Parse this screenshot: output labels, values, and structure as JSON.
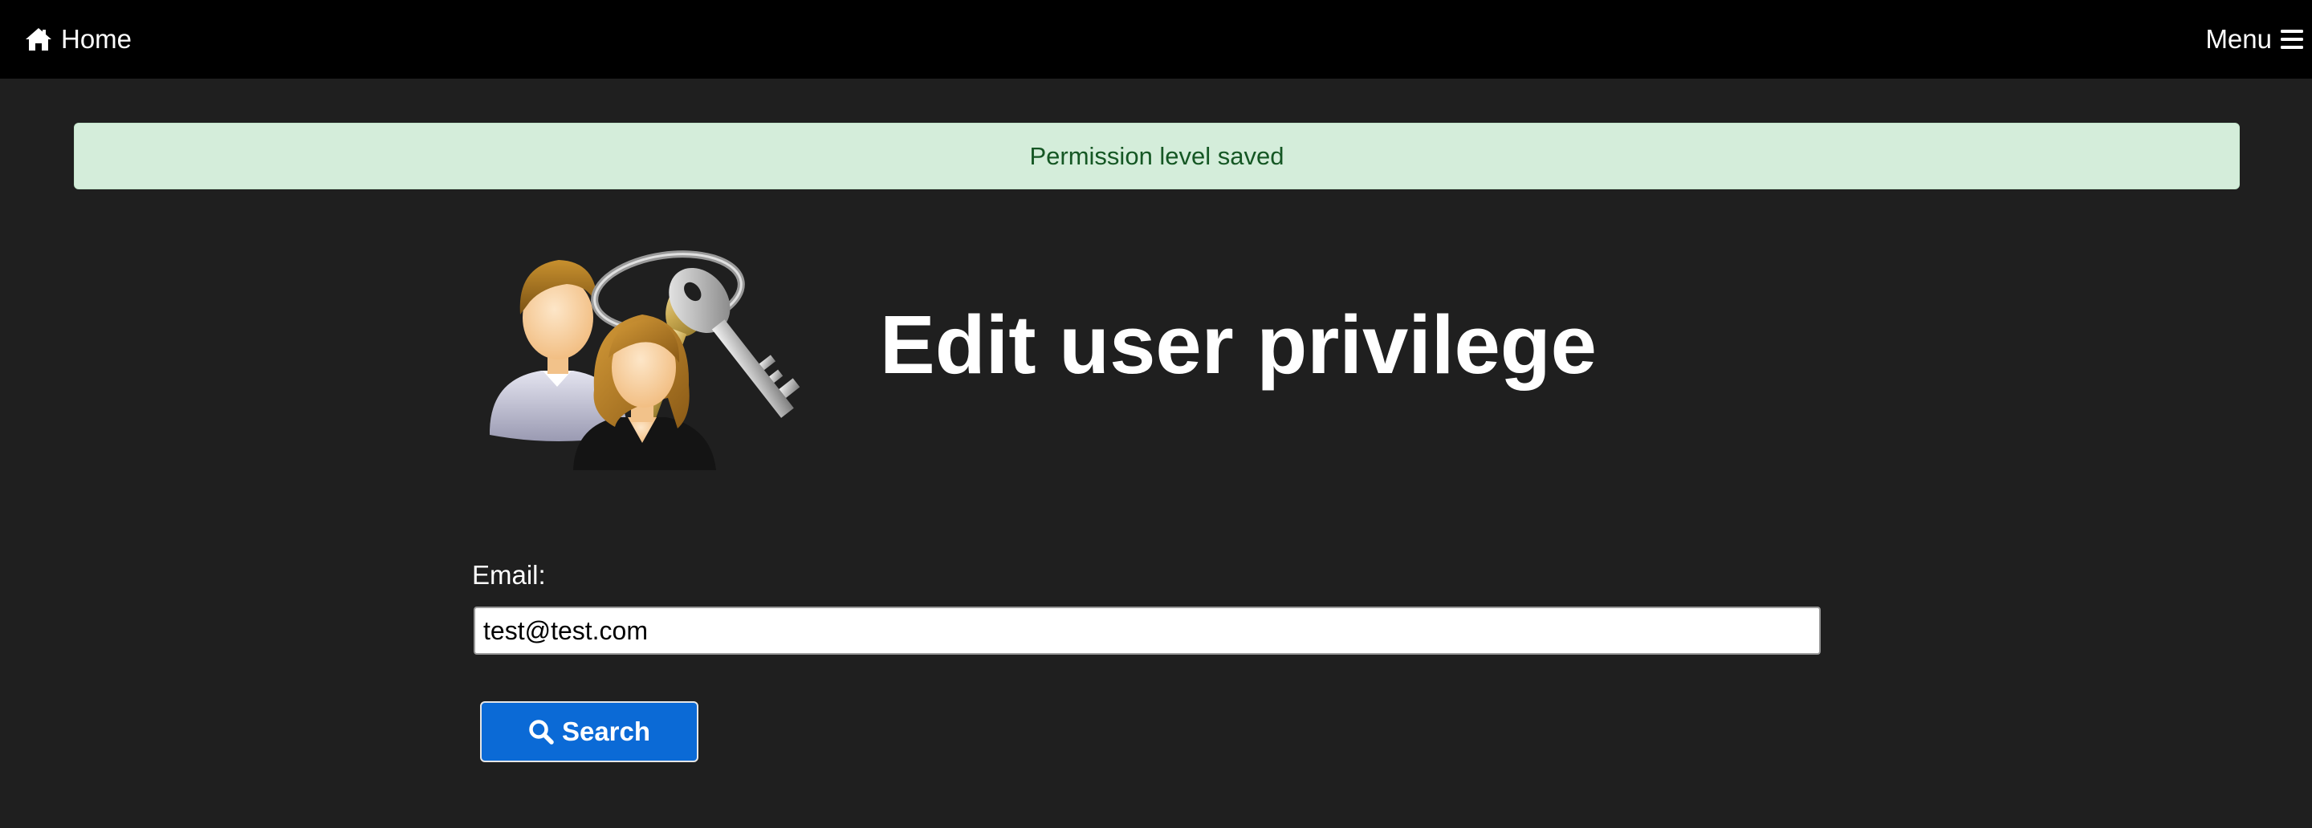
{
  "navbar": {
    "home_label": "Home",
    "home_icon": "home-icon",
    "menu_label": "Menu",
    "menu_icon": "hamburger-icon",
    "background": "#000000"
  },
  "alert": {
    "message": "Permission level saved",
    "background": "#d4edda",
    "text_color": "#155724"
  },
  "hero": {
    "image": "users-with-keys-illustration",
    "title": "Edit user privilege"
  },
  "form": {
    "email_label": "Email:",
    "email_value": "test@test.com",
    "search_label": "Search",
    "search_icon": "magnifier-icon",
    "button_color": "#0b6ad6"
  }
}
